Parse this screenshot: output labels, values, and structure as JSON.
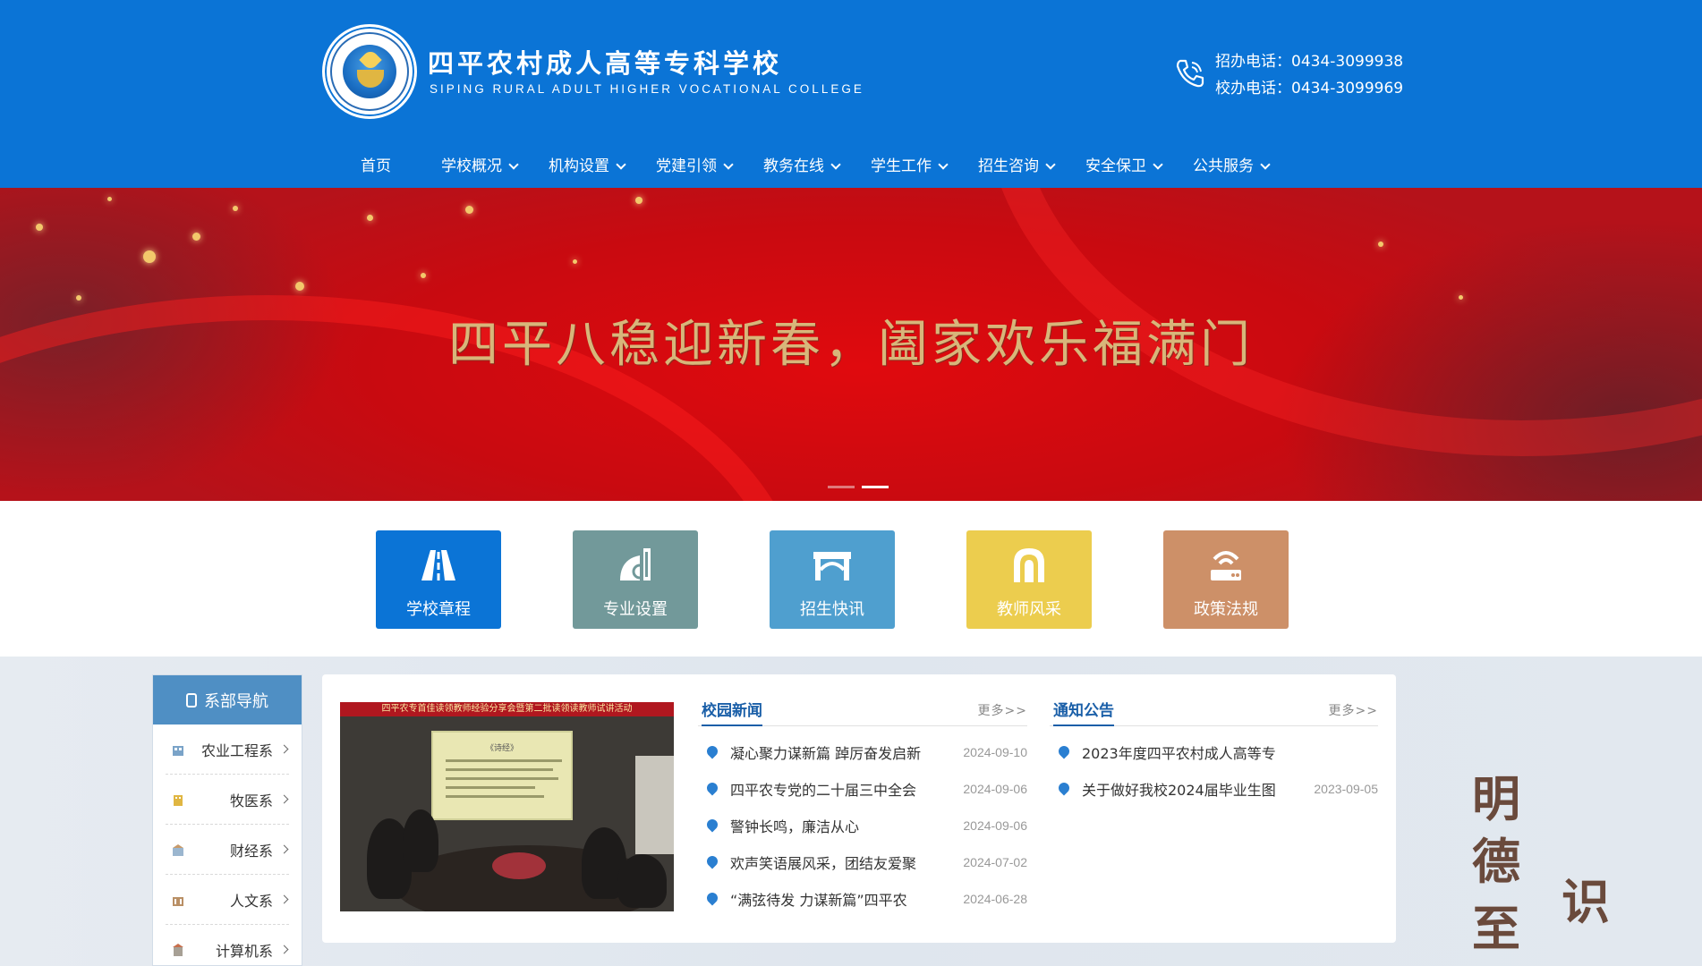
{
  "header": {
    "school_name_cn": "四平农村成人高等专科学校",
    "school_name_en": "SIPING RURAL ADULT HIGHER VOCATIONAL COLLEGE",
    "phone_admissions": "招办电话：0434-3099938",
    "phone_office": "校办电话：0434-3099969"
  },
  "nav": [
    {
      "label": "首页",
      "dropdown": false
    },
    {
      "label": "学校概况",
      "dropdown": true
    },
    {
      "label": "机构设置",
      "dropdown": true
    },
    {
      "label": "党建引领",
      "dropdown": true
    },
    {
      "label": "教务在线",
      "dropdown": true
    },
    {
      "label": "学生工作",
      "dropdown": true
    },
    {
      "label": "招生咨询",
      "dropdown": true
    },
    {
      "label": "安全保卫",
      "dropdown": true
    },
    {
      "label": "公共服务",
      "dropdown": true
    }
  ],
  "banner": {
    "title": "四平八稳迎新春，阖家欢乐福满门",
    "slide_count": 2,
    "active_slide": 2
  },
  "quick_links": [
    {
      "label": "学校章程",
      "color": "#0b74d6",
      "icon": "road-icon"
    },
    {
      "label": "专业设置",
      "color": "#72999a",
      "icon": "shapes-icon"
    },
    {
      "label": "招生快讯",
      "color": "#4f9fcf",
      "icon": "gate-icon"
    },
    {
      "label": "教师风采",
      "color": "#eccd4e",
      "icon": "arch-icon"
    },
    {
      "label": "政策法规",
      "color": "#cd9068",
      "icon": "router-icon"
    }
  ],
  "sidebar": {
    "title": "系部导航",
    "items": [
      {
        "label": "农业工程系"
      },
      {
        "label": "牧医系"
      },
      {
        "label": "财经系"
      },
      {
        "label": "人文系"
      },
      {
        "label": "计算机系"
      }
    ]
  },
  "news_photo": {
    "banner_text": "四平农专首佳读领教师经验分享会暨第二批读领读教师试讲活动",
    "screen_text": "《诗经》"
  },
  "campus_news": {
    "title": "校园新闻",
    "more": "更多>>",
    "items": [
      {
        "title": "凝心聚力谋新篇 踔厉奋发启新",
        "date": "2024-09-10"
      },
      {
        "title": "四平农专党的二十届三中全会",
        "date": "2024-09-06"
      },
      {
        "title": "警钟长鸣，廉洁从心",
        "date": "2024-09-06"
      },
      {
        "title": "欢声笑语展风采，团结友爱聚",
        "date": "2024-07-02"
      },
      {
        "title": "“满弦待发 力谋新篇”四平农",
        "date": "2024-06-28"
      }
    ]
  },
  "notices": {
    "title": "通知公告",
    "more": "更多>>",
    "items": [
      {
        "title": "2023年度四平农村成人高等专",
        "date": ""
      },
      {
        "title": "关于做好我校2024届毕业生图",
        "date": "2023-09-05"
      }
    ]
  },
  "calligraphy": [
    "明",
    "德",
    "至",
    "识"
  ]
}
